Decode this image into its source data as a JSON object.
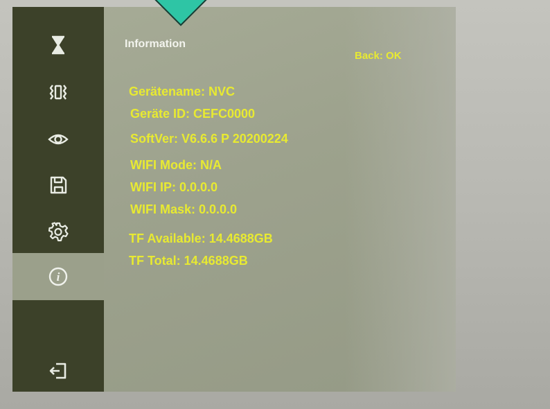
{
  "header": {
    "title": "Information",
    "back": "Back: OK"
  },
  "info_lines": [
    "Gerätename: NVC",
    "Geräte ID: CEFC0000",
    "SoftVer: V6.6.6 P 20200224",
    "WIFI Mode: N/A",
    "WIFI IP: 0.0.0.0",
    "WIFI Mask: 0.0.0.0",
    "TF Available: 14.4688GB",
    "TF Total: 14.4688GB"
  ],
  "sidebar_icons": [
    "hourglass-icon",
    "vibration-icon",
    "eye-icon",
    "save-icon",
    "gear-icon",
    "info-icon",
    "exit-icon"
  ],
  "colors": {
    "sidebar": "#3c4129",
    "panel": "#9fa48f",
    "text_yellow": "#e8ea31",
    "text_white": "#f3f4ee",
    "marker": "#2ec5a5"
  }
}
